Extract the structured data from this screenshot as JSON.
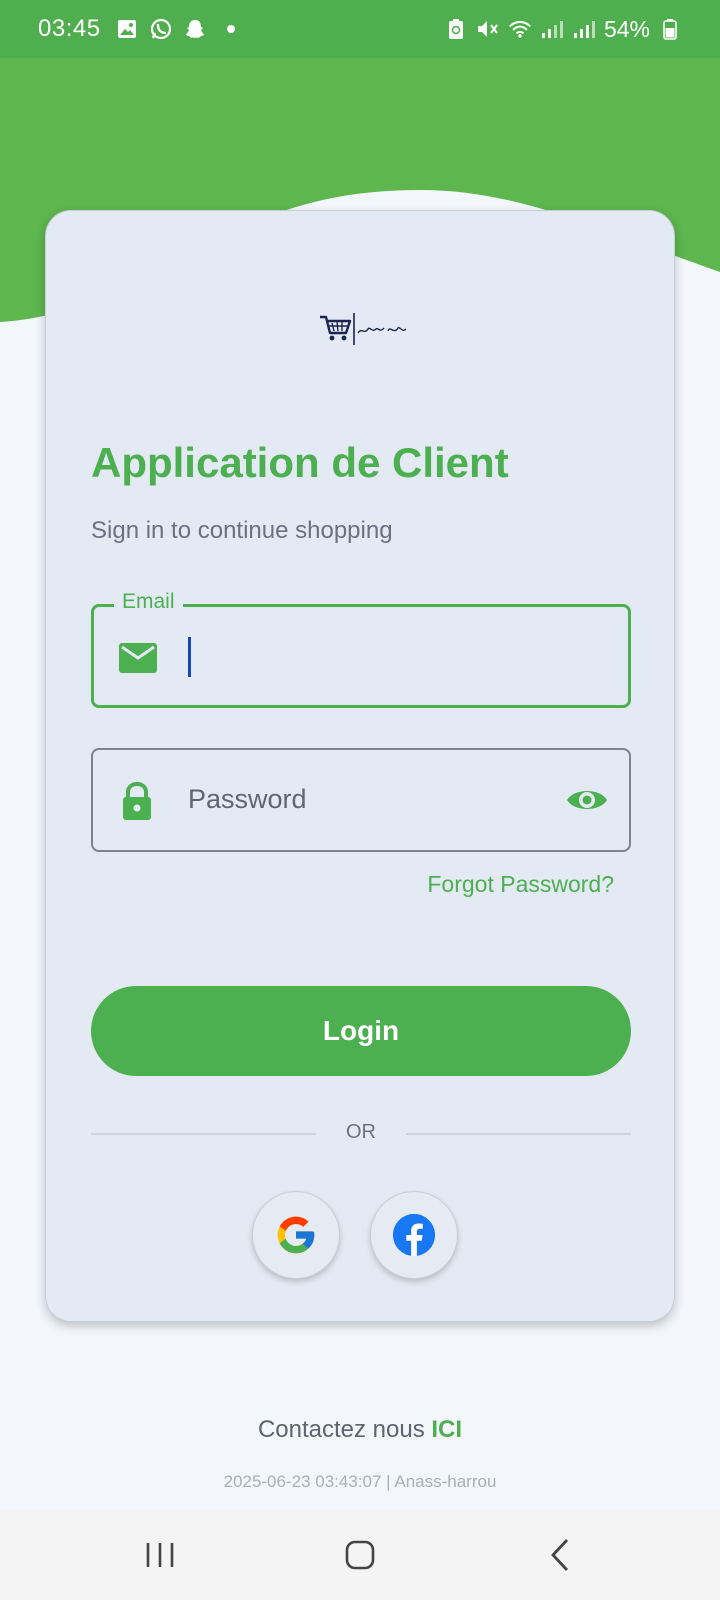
{
  "status_bar": {
    "time": "03:45",
    "battery": "54%",
    "notification_icons": [
      "gallery-icon",
      "whatsapp-icon",
      "snapchat-icon",
      "dot"
    ],
    "system_icons": [
      "battery-saver-icon",
      "mute-icon",
      "wifi-icon",
      "signal-icon",
      "signal-icon"
    ]
  },
  "login": {
    "app_title": "Application de Client",
    "subtitle": "Sign in to continue shopping",
    "email_label": "Email",
    "email_value": "",
    "password_placeholder": "Password",
    "forgot_password": "Forgot Password?",
    "login_button": "Login",
    "or_divider": "OR"
  },
  "social": {
    "google_icon": "google-icon",
    "facebook_icon": "facebook-icon"
  },
  "footer": {
    "contact_text": "Contactez nous",
    "contact_link": "ICI",
    "meta": "2025-06-23 03:43:07 | Anass-harrou"
  },
  "colors": {
    "primary_green": "#4caf50",
    "status_bar_green": "#4fae4d",
    "card_bg": "#e4eaf3",
    "page_bg": "#f3f6fb"
  }
}
